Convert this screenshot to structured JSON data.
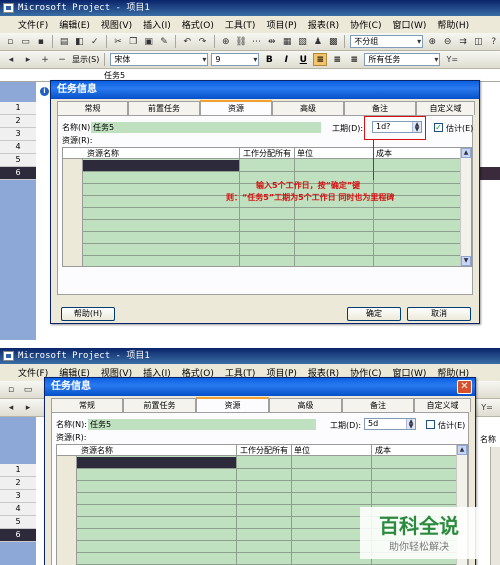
{
  "top_window": {
    "title": "Microsoft Project - 项目1",
    "menu": [
      "文件(F)",
      "编辑(E)",
      "视图(V)",
      "插入(I)",
      "格式(O)",
      "工具(T)",
      "项目(P)",
      "报表(R)",
      "协作(C)",
      "窗口(W)",
      "帮助(H)"
    ],
    "toolbar": {
      "group_combo": "不分组",
      "display_label": "显示(S)",
      "font": "宋体",
      "font_size": "9",
      "bold": "B",
      "italic": "I",
      "underline": "U",
      "filter": "所有任务",
      "filter_icon": "Y="
    },
    "entry_text": "任务5",
    "row_numbers": [
      "1",
      "2",
      "3",
      "4",
      "5",
      "6"
    ],
    "selected_row": "6",
    "info_marker": "i",
    "dialog": {
      "title": "任务信息",
      "tabs": [
        "常规",
        "前置任务",
        "资源",
        "高级",
        "备注",
        "自定义域"
      ],
      "active_tab": "资源",
      "name_label": "名称(N):",
      "name_value": "任务5",
      "duration_label": "工期(D):",
      "duration_value": "1d?",
      "estimated_label": "估计(E)",
      "estimated_mark": "✓",
      "resources_label": "资源(R):",
      "columns": [
        "资源名称",
        "工作分配所有",
        "单位",
        "成本"
      ],
      "help_button": "帮助(H)",
      "ok_button": "确定",
      "cancel_button": "取消"
    },
    "annotation": {
      "line1": "输入5个工作日，按“确定”键",
      "line2": "则：“任务5”工期为5个工作日  同时也为里程碑"
    }
  },
  "bottom_window": {
    "title": "Microsoft Project - 项目1",
    "menu": [
      "文件(F)",
      "编辑(E)",
      "视图(V)",
      "插入(I)",
      "格式(O)",
      "工具(T)",
      "项目(P)",
      "报表(R)",
      "协作(C)",
      "窗口(W)",
      "帮助(H)"
    ],
    "row_numbers": [
      "1",
      "2",
      "3",
      "4",
      "5",
      "6"
    ],
    "selected_row": "6",
    "side_text": "名称",
    "filter_icon": "Y=",
    "dialog": {
      "title": "任务信息",
      "tabs": [
        "常规",
        "前置任务",
        "资源",
        "高级",
        "备注",
        "自定义域"
      ],
      "active_tab": "资源",
      "name_label": "名称(N):",
      "name_value": "任务5",
      "duration_label": "工期(D):",
      "duration_value": "5d",
      "estimated_label": "估计(E)",
      "resources_label": "资源(R):",
      "columns": [
        "资源名称",
        "工作分配所有",
        "单位",
        "成本"
      ]
    }
  },
  "watermark": {
    "title": "百科全说",
    "subtitle": "助你轻松解决"
  }
}
